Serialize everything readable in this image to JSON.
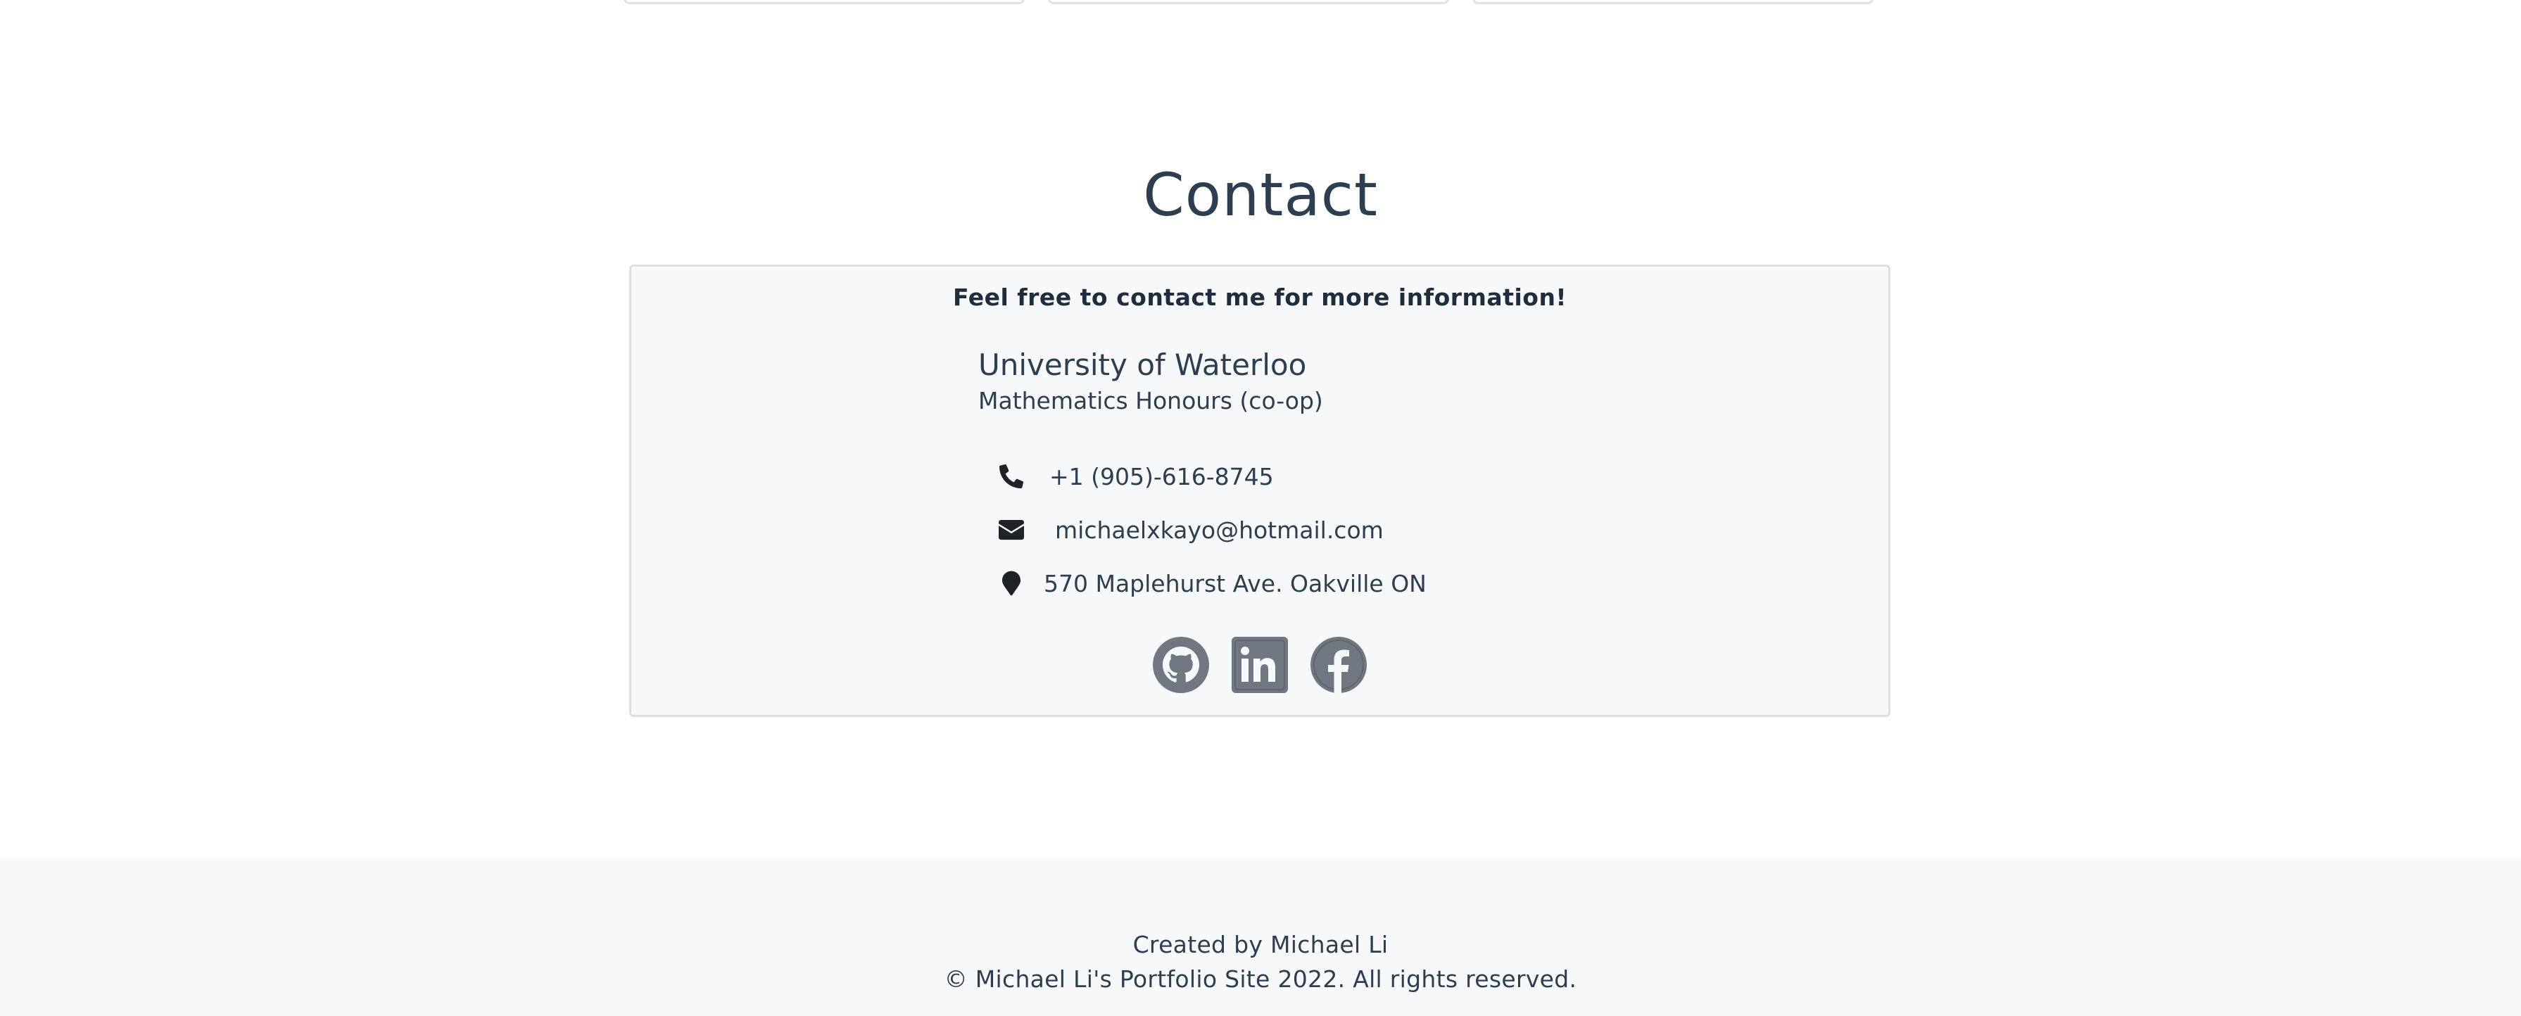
{
  "contact": {
    "title": "Contact",
    "intro": "Feel free to contact me for more information!",
    "school": "University of Waterloo",
    "program": "Mathematics Honours (co-op)",
    "items": [
      {
        "icon": "phone-icon",
        "text": "+1 (905)-616-8745"
      },
      {
        "icon": "envelope-icon",
        "text": "michaelxkayo@hotmail.com"
      },
      {
        "icon": "map-marker-icon",
        "text": "570 Maplehurst Ave. Oakville ON"
      }
    ],
    "social": [
      {
        "icon": "github-icon",
        "color": "#707780"
      },
      {
        "icon": "linkedin-icon",
        "color": "#707780"
      },
      {
        "icon": "facebook-icon",
        "color": "#707780"
      }
    ]
  },
  "footer": {
    "credit": "Created by Michael Li",
    "copyright": "© Michael Li's Portfolio Site 2022. All rights reserved."
  },
  "colors": {
    "text": "#2c3e50",
    "card_bg": "#f7f8fa",
    "card_border": "#dcdfe3",
    "icon_gray": "#707780",
    "icon_dark": "#1f2328"
  }
}
